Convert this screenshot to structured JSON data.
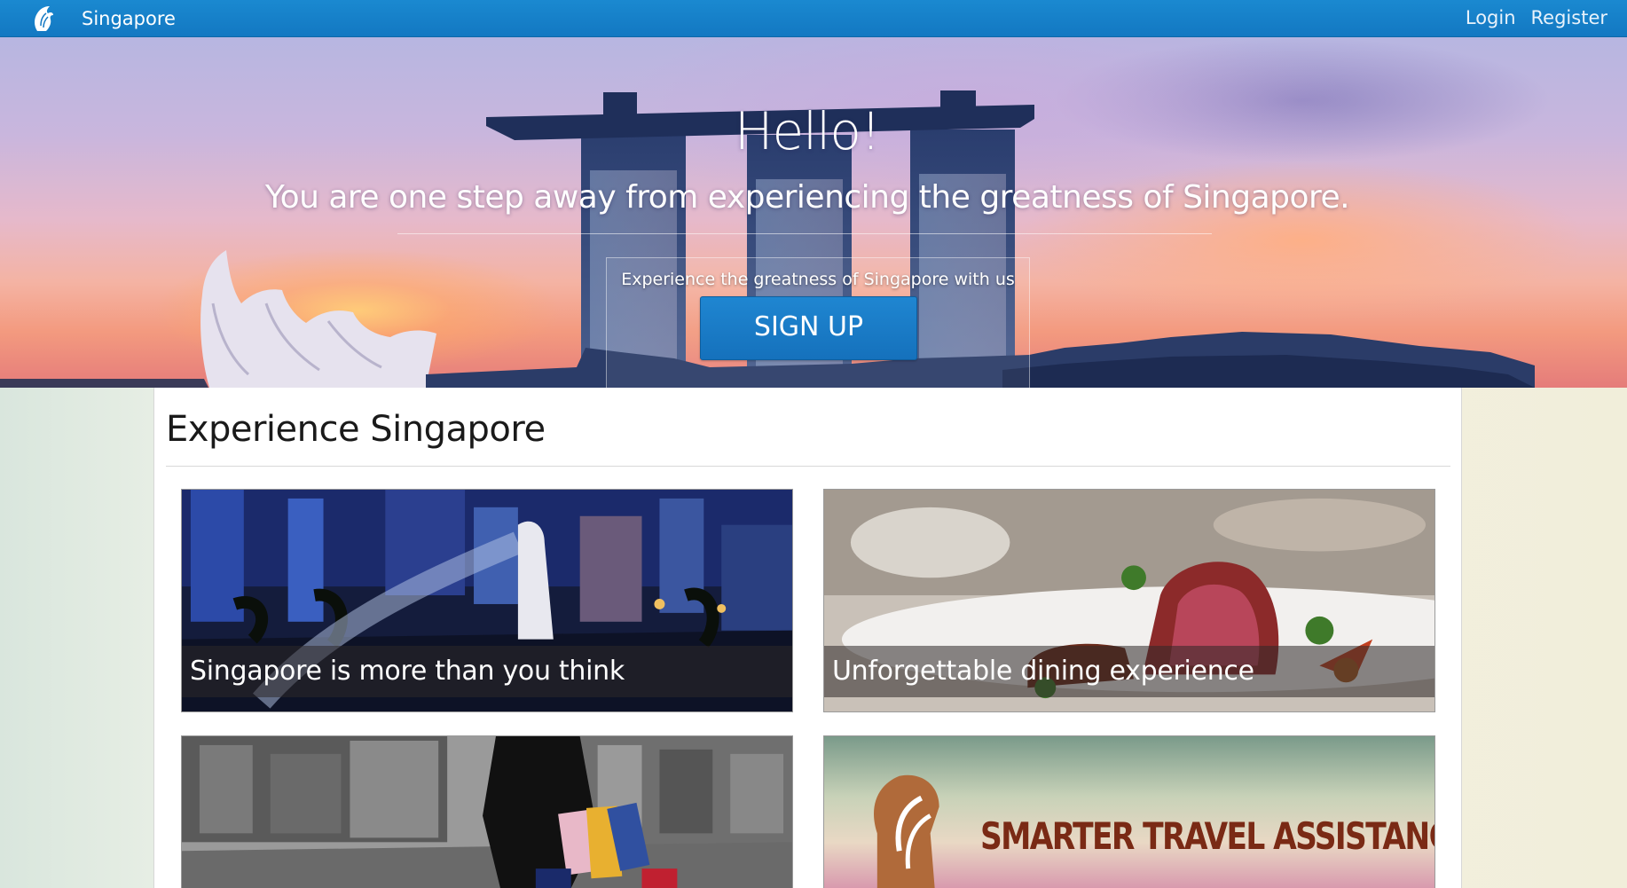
{
  "navbar": {
    "brand_name": "Singapore",
    "brand_icon": "merlion-logo-icon",
    "login_label": "Login",
    "register_label": "Register"
  },
  "hero": {
    "title": "Hello!",
    "subtitle": "You are one step away from experiencing the greatness of Singapore.",
    "tagline": "Experience the greatness of Singapore with us",
    "signup_label": "SIGN UP"
  },
  "main": {
    "section_title": "Experience Singapore",
    "cards": [
      {
        "caption": "Singapore is more than you think",
        "image": "merlion-night-skyline-image"
      },
      {
        "caption": "Unforgettable dining experience",
        "image": "steak-dish-image"
      },
      {
        "caption": "",
        "image": "shopping-street-image"
      },
      {
        "caption": "",
        "banner_text": "SMARTER TRAVEL ASSISTANC",
        "image": "travel-assistant-banner-image"
      }
    ]
  },
  "colors": {
    "navbar": "#1a89d0",
    "button": "#1f86d1",
    "banner_text": "#7a2a15"
  }
}
